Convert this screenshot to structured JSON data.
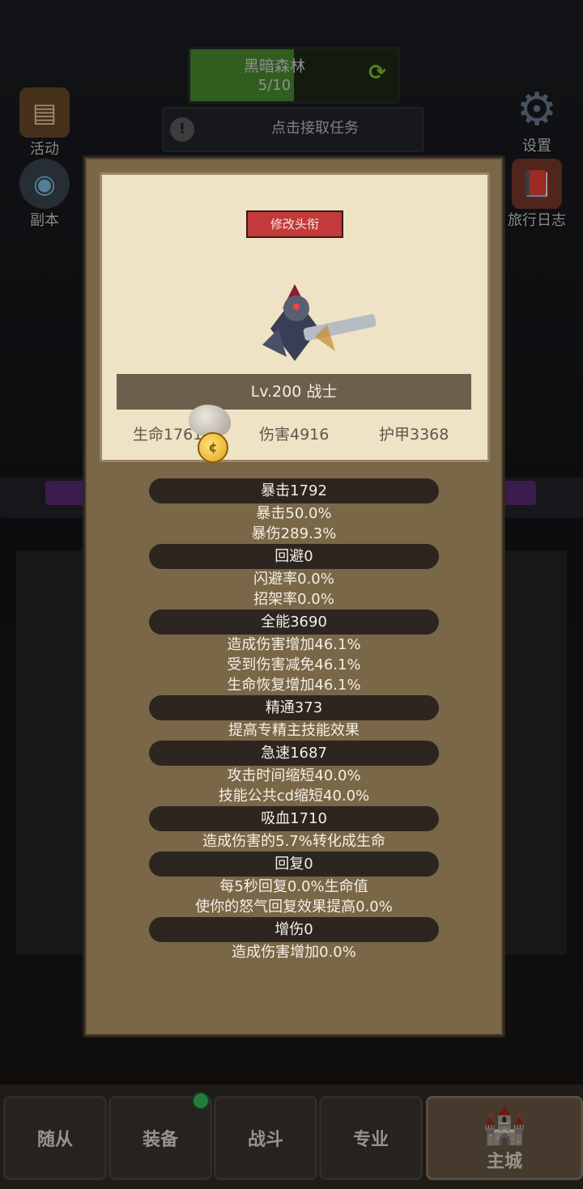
{
  "area": {
    "name": "黑暗森林",
    "progress": "5/10",
    "progress_fraction": 0.5,
    "refresh_icon": "refresh-icon"
  },
  "quest": {
    "text": "点击接取任务",
    "icon": "alert-icon"
  },
  "side": {
    "left": [
      {
        "label": "活动",
        "icon": "scroll-icon"
      },
      {
        "label": "副本",
        "icon": "portal-icon"
      }
    ],
    "right": [
      {
        "label": "设置",
        "icon": "gear-icon"
      },
      {
        "label": "旅行日志",
        "icon": "book-icon"
      }
    ]
  },
  "modal": {
    "rename_button": "修改头衔",
    "level_class": "Lv.200 战士",
    "basic_stats": {
      "hp": "生命17611",
      "damage": "伤害4916",
      "armor": "护甲3368"
    },
    "stats": [
      {
        "title": "暴击1792",
        "lines": [
          "暴击50.0%",
          "暴伤289.3%"
        ]
      },
      {
        "title": "回避0",
        "lines": [
          "闪避率0.0%",
          "招架率0.0%"
        ]
      },
      {
        "title": "全能3690",
        "lines": [
          "造成伤害增加46.1%",
          "受到伤害减免46.1%",
          "生命恢复增加46.1%"
        ]
      },
      {
        "title": "精通373",
        "lines": [
          "提高专精主技能效果"
        ]
      },
      {
        "title": "急速1687",
        "lines": [
          "攻击时间缩短40.0%",
          "技能公共cd缩短40.0%"
        ]
      },
      {
        "title": "吸血1710",
        "lines": [
          "造成伤害的5.7%转化成生命"
        ]
      },
      {
        "title": "回复0",
        "lines": [
          "每5秒回复0.0%生命值",
          "使你的怒气回复效果提高0.0%"
        ]
      },
      {
        "title": "增伤0",
        "lines": [
          "造成伤害增加0.0%"
        ]
      }
    ]
  },
  "nav": {
    "items": [
      {
        "label": "随从",
        "active": false,
        "badge": false
      },
      {
        "label": "装备",
        "active": false,
        "badge": true
      },
      {
        "label": "战斗",
        "active": false,
        "badge": false
      },
      {
        "label": "专业",
        "active": false,
        "badge": false
      },
      {
        "label": "主城",
        "active": true,
        "badge": false
      }
    ]
  },
  "colors": {
    "modal_bg": "#7a6748",
    "card_bg": "#efe3c6",
    "rename_red": "#c23a3a",
    "area_green": "#4c8f2e"
  }
}
